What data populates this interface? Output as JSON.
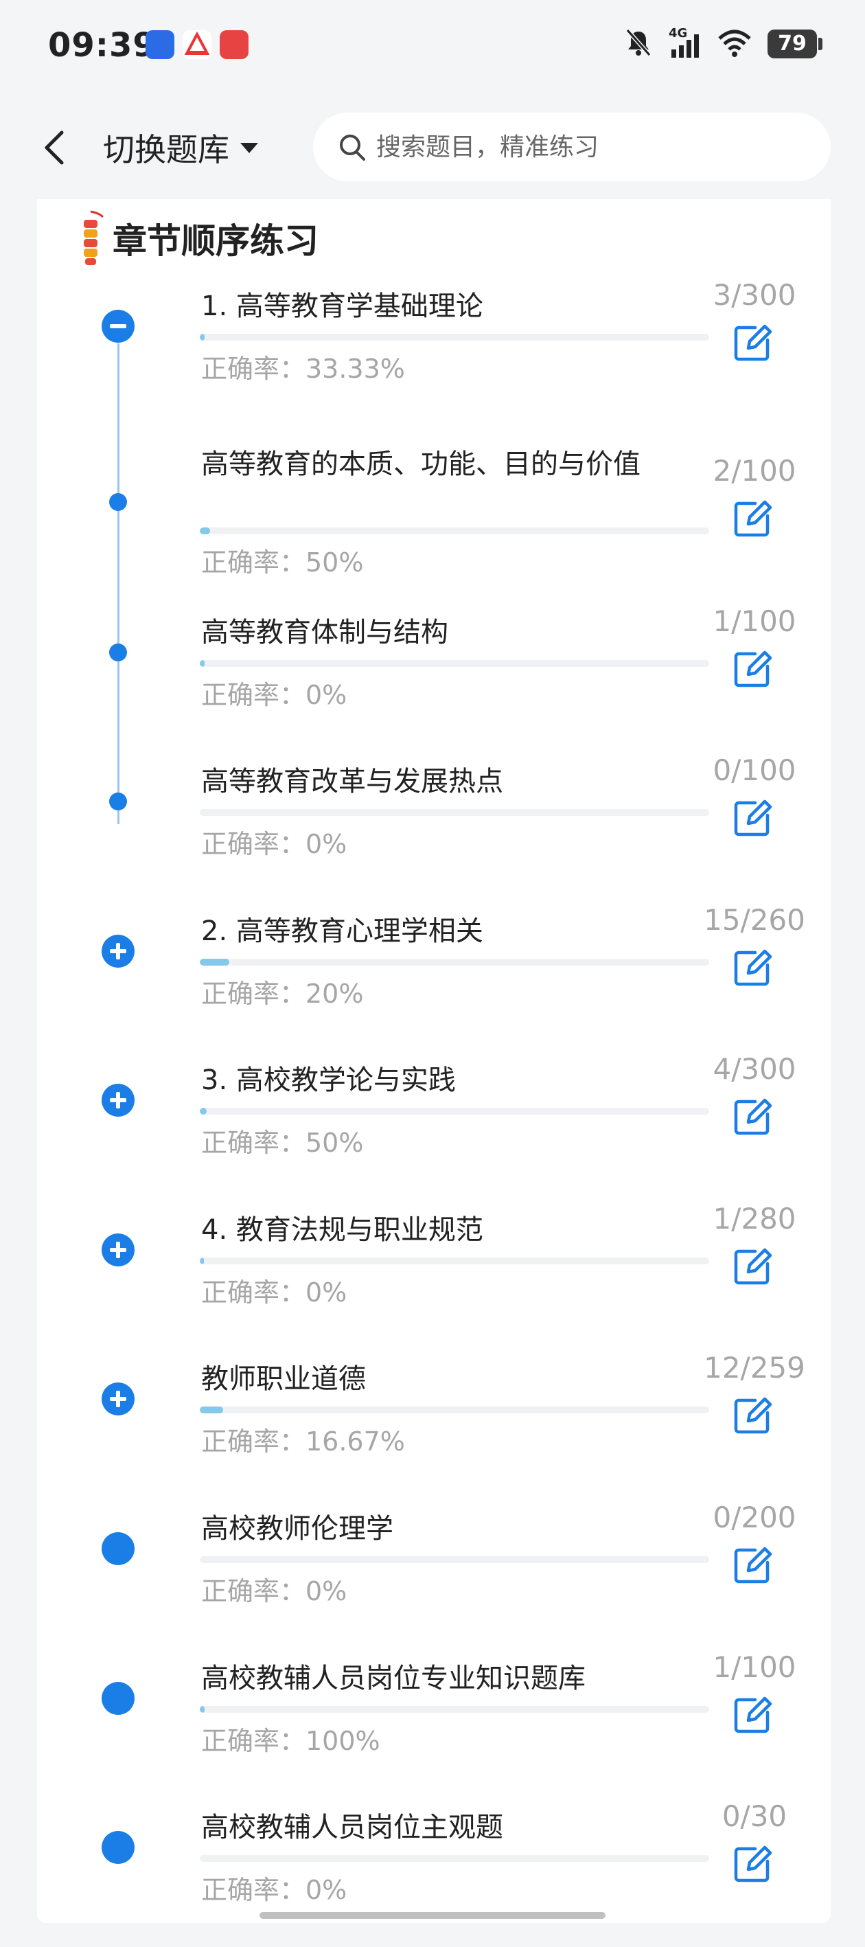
{
  "status_bar": {
    "time": "09:39",
    "network": "4G",
    "battery": "79"
  },
  "header": {
    "back_icon": "chevron-left-icon",
    "bank_label": "切换题库",
    "search_placeholder": "搜索题目，精准练习"
  },
  "section": {
    "title": "章节顺序练习"
  },
  "rows": [
    {
      "title": "1. 高等教育学基础理论",
      "rate": "正确率：33.33%",
      "count": "3/300",
      "progress": 0.01,
      "marker": "minus"
    },
    {
      "title": "高等教育的本质、功能、目的与价值",
      "rate": "正确率：50%",
      "count": "2/100",
      "progress": 0.02,
      "marker": "dot"
    },
    {
      "title": "高等教育体制与结构",
      "rate": "正确率：0%",
      "count": "1/100",
      "progress": 0.01,
      "marker": "dot"
    },
    {
      "title": "高等教育改革与发展热点",
      "rate": "正确率：0%",
      "count": "0/100",
      "progress": 0,
      "marker": "dot"
    },
    {
      "title": "2. 高等教育心理学相关",
      "rate": "正确率：20%",
      "count": "15/260",
      "progress": 0.058,
      "marker": "plus"
    },
    {
      "title": "3. 高校教学论与实践",
      "rate": "正确率：50%",
      "count": "4/300",
      "progress": 0.013,
      "marker": "plus"
    },
    {
      "title": "4. 教育法规与职业规范",
      "rate": "正确率：0%",
      "count": "1/280",
      "progress": 0.004,
      "marker": "plus"
    },
    {
      "title": "教师职业道德",
      "rate": "正确率：16.67%",
      "count": "12/259",
      "progress": 0.046,
      "marker": "plus"
    },
    {
      "title": "高校教师伦理学",
      "rate": "正确率：0%",
      "count": "0/200",
      "progress": 0,
      "marker": "filled"
    },
    {
      "title": "高校教辅人员岗位专业知识题库",
      "rate": "正确率：100%",
      "count": "1/100",
      "progress": 0.01,
      "marker": "filled"
    },
    {
      "title": "高校教辅人员岗位主观题",
      "rate": "正确率：0%",
      "count": "0/30",
      "progress": 0,
      "marker": "filled"
    }
  ]
}
